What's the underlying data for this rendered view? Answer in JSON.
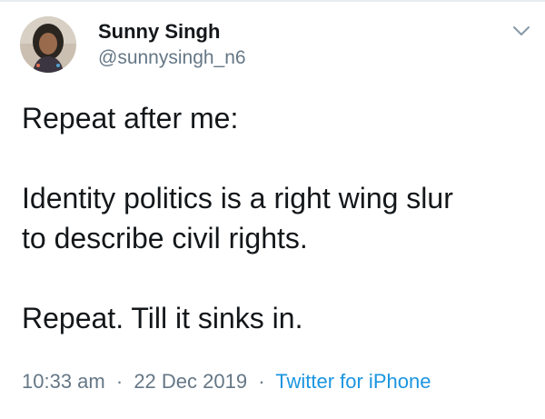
{
  "user": {
    "display_name": "Sunny Singh",
    "handle": "@sunnysingh_n6"
  },
  "tweet": {
    "paragraphs": [
      "Repeat after me:",
      "Identity politics is a right wing slur to describe civil rights.",
      "Repeat. Till it sinks in."
    ],
    "line_2a": "Identity politics is a right wing slur",
    "line_2b": "to describe civil rights."
  },
  "meta": {
    "time": "10:33 am",
    "date": "22 Dec 2019",
    "separator": "·",
    "source": "Twitter for iPhone"
  },
  "icons": {
    "menu": "chevron-down-icon",
    "avatar": "profile-photo"
  },
  "colors": {
    "text": "#14171a",
    "secondary": "#657786",
    "link": "#1b95e0",
    "border": "#e6ecf0"
  }
}
